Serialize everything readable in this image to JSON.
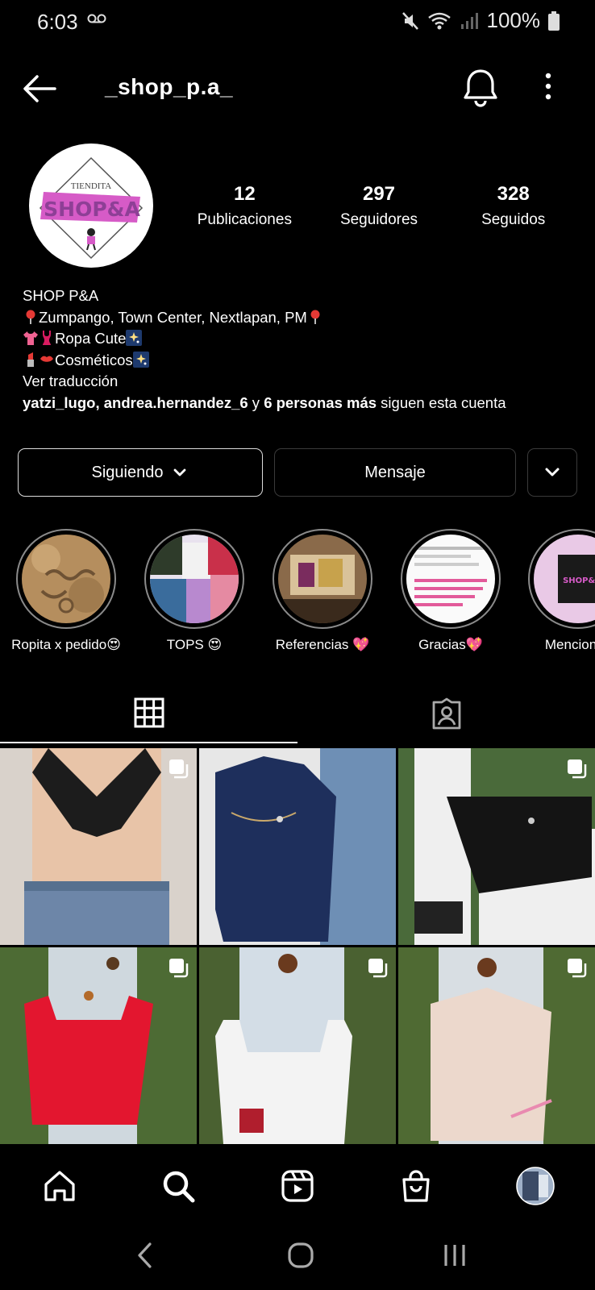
{
  "status": {
    "time": "6:03",
    "battery": "100%"
  },
  "header": {
    "username": "_shop_p.a_"
  },
  "profile": {
    "logo_top": "TIENDITA",
    "logo_main": "SHOP&A",
    "stats": [
      {
        "number": "12",
        "label": "Publicaciones"
      },
      {
        "number": "297",
        "label": "Seguidores"
      },
      {
        "number": "328",
        "label": "Seguidos"
      }
    ],
    "bio": {
      "name": "SHOP P&A",
      "line_location": "Zumpango, Town Center, Nextlapan, PM",
      "line_clothes": "Ropa Cute",
      "line_cosmetics": "Cosméticos",
      "translate": "Ver traducción",
      "followed_by_1": "yatzi_lugo",
      "followed_by_sep": ", ",
      "followed_by_2": "andrea.hernandez_6",
      "followed_by_mid": " y ",
      "followed_by_more": "6 personas más",
      "followed_by_tail": " siguen esta cuenta"
    }
  },
  "actions": {
    "following": "Siguiendo",
    "message": "Mensaje"
  },
  "highlights": [
    {
      "label": "Ropita x pedido😍"
    },
    {
      "label": "TOPS 😍"
    },
    {
      "label": "Referencias 💖"
    },
    {
      "label": "Gracias💖"
    },
    {
      "label": "Menciones"
    }
  ],
  "tabs": [
    "posts-grid",
    "tagged"
  ],
  "colors": {
    "background": "#000000",
    "accent_pink": "#d65bc7",
    "logo_purple": "#8e3f96"
  }
}
